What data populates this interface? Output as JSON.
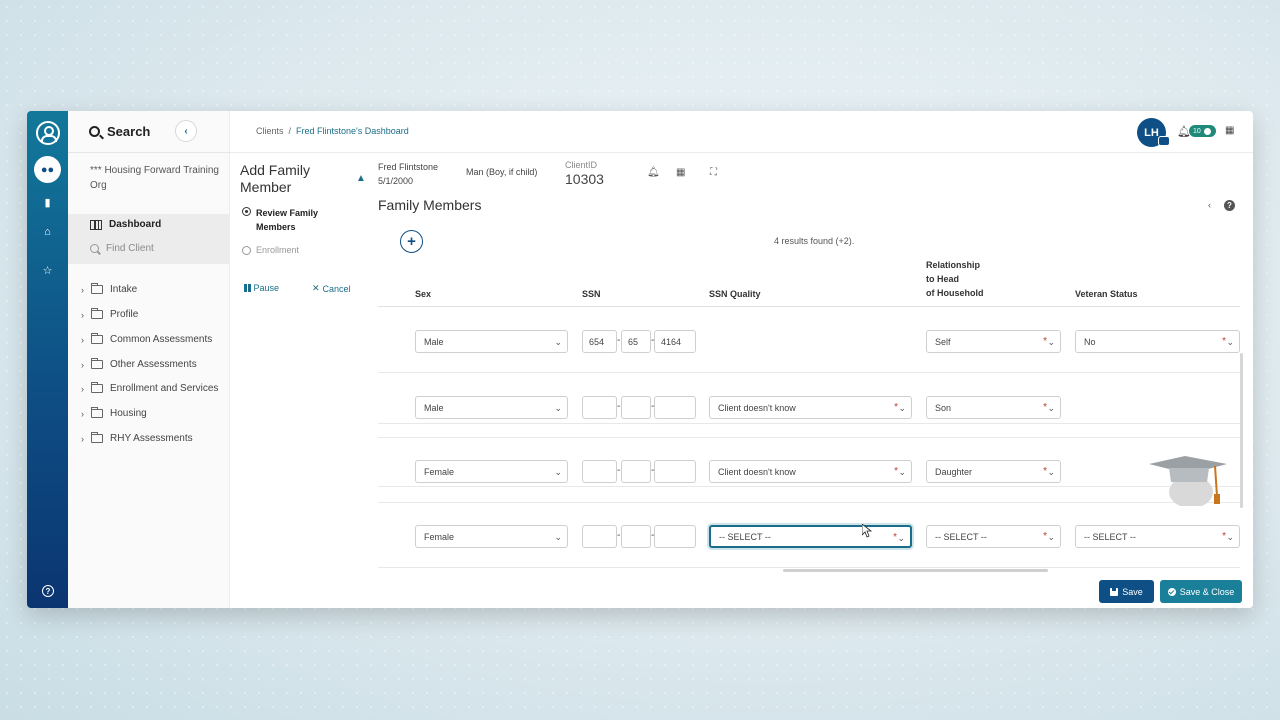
{
  "sidebar": {
    "search_label": "Search",
    "org_name": "*** Housing Forward Training Org",
    "nav": {
      "dashboard": "Dashboard",
      "find_client": "Find Client"
    },
    "folders": [
      {
        "label": "Intake"
      },
      {
        "label": "Profile"
      },
      {
        "label": "Common Assessments"
      },
      {
        "label": "Other Assessments"
      },
      {
        "label": "Enrollment and Services"
      },
      {
        "label": "Housing"
      },
      {
        "label": "RHY Assessments"
      }
    ]
  },
  "header": {
    "breadcrumb": [
      "Clients",
      "Fred Flintstone's Dashboard"
    ],
    "avatar_initials": "LH",
    "notification_count": "10"
  },
  "wizard": {
    "title": "Add Family Member",
    "steps": [
      {
        "label": "Review Family Members",
        "state": "current"
      },
      {
        "label": "Enrollment",
        "state": "future"
      }
    ],
    "pause_label": "Pause",
    "cancel_label": "Cancel"
  },
  "client": {
    "name": "Fred Flintstone",
    "dob": "5/1/2000",
    "gender": "Man (Boy, if child)",
    "id_label": "ClientID",
    "id": "10303"
  },
  "section": {
    "title": "Family Members",
    "results_text": "4 results found (+2)."
  },
  "table": {
    "columns": {
      "sex": "Sex",
      "ssn": "SSN",
      "ssn_quality": "SSN Quality",
      "relationship_1": "Relationship",
      "relationship_2": "to Head",
      "relationship_3": "of Household",
      "veteran": "Veteran Status"
    },
    "rows": [
      {
        "sex": "Male",
        "ssn1": "654",
        "ssn2": "65",
        "ssn3": "4164",
        "ssn_quality": "",
        "relationship": "Self",
        "veteran": "No"
      },
      {
        "sex": "Male",
        "ssn1": "",
        "ssn2": "",
        "ssn3": "",
        "ssn_quality": "Client doesn't know",
        "relationship": "Son",
        "veteran": ""
      },
      {
        "sex": "Female",
        "ssn1": "",
        "ssn2": "",
        "ssn3": "",
        "ssn_quality": "Client doesn't know",
        "relationship": "Daughter",
        "veteran": ""
      },
      {
        "sex": "Female",
        "ssn1": "",
        "ssn2": "",
        "ssn3": "",
        "ssn_quality": "-- SELECT --",
        "relationship": "-- SELECT --",
        "veteran": "-- SELECT --"
      }
    ]
  },
  "footer": {
    "save_label": "Save",
    "save_close_label": "Save & Close"
  },
  "colors": {
    "brand_dark": "#0e4f85",
    "brand_teal": "#1a7f99",
    "required": "#c0392b"
  },
  "icons": [
    "search-icon",
    "chevron-left-icon",
    "map-icon",
    "folder-icon",
    "bell-icon",
    "calendar-icon",
    "pin-icon",
    "expand-icon",
    "plus-icon",
    "help-icon",
    "save-icon",
    "check-circle-icon",
    "pause-icon",
    "close-icon"
  ]
}
